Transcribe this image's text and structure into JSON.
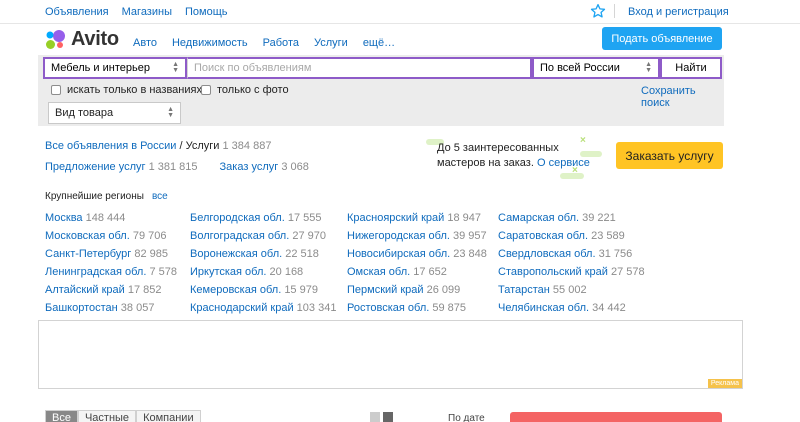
{
  "topbar": {
    "links": [
      "Объявления",
      "Магазины",
      "Помощь"
    ],
    "login": "Вход и регистрация"
  },
  "header": {
    "logo_text": "Avito",
    "categories": [
      "Авто",
      "Недвижимость",
      "Работа",
      "Услуги",
      "ещё…"
    ],
    "post_button": "Подать объявление"
  },
  "search": {
    "category": "Мебель и интерьер",
    "query_placeholder": "Поиск по объявлениям",
    "region": "По всей России",
    "find_button": "Найти",
    "only_titles": "искать только в названиях",
    "only_photo": "только с фото",
    "save_search": "Сохранить поиск",
    "product_type": "Вид товара"
  },
  "breadcrumb": {
    "all_ads": "Все объявления в России",
    "separator": "/",
    "current": "Услуги",
    "current_count": "1 384 887"
  },
  "offers": [
    {
      "label": "Предложение услуг",
      "count": "1 381 815"
    },
    {
      "label": "Заказ услуг",
      "count": "3 068"
    }
  ],
  "promo": {
    "line1": "До 5 заинтересованных",
    "line2": "мастеров на заказ.",
    "about": "О сервисе",
    "order_button": "Заказать услугу"
  },
  "regions": {
    "heading": "Крупнейшие регионы",
    "all": "все",
    "columns": [
      [
        {
          "name": "Москва",
          "count": "148 444"
        },
        {
          "name": "Московская обл.",
          "count": "79 706"
        },
        {
          "name": "Санкт-Петербург",
          "count": "82 985"
        },
        {
          "name": "Ленинградская обл.",
          "count": "7 578"
        },
        {
          "name": "Алтайский край",
          "count": "17 852"
        },
        {
          "name": "Башкортостан",
          "count": "38 057"
        }
      ],
      [
        {
          "name": "Белгородская обл.",
          "count": "17 555"
        },
        {
          "name": "Волгоградская обл.",
          "count": "27 970"
        },
        {
          "name": "Воронежская обл.",
          "count": "22 518"
        },
        {
          "name": "Иркутская обл.",
          "count": "20 168"
        },
        {
          "name": "Кемеровская обл.",
          "count": "15 979"
        },
        {
          "name": "Краснодарский край",
          "count": "103 341"
        }
      ],
      [
        {
          "name": "Красноярский край",
          "count": "18 947"
        },
        {
          "name": "Нижегородская обл.",
          "count": "39 957"
        },
        {
          "name": "Новосибирская обл.",
          "count": "23 848"
        },
        {
          "name": "Омская обл.",
          "count": "17 652"
        },
        {
          "name": "Пермский край",
          "count": "26 099"
        },
        {
          "name": "Ростовская обл.",
          "count": "59 875"
        }
      ],
      [
        {
          "name": "Самарская обл.",
          "count": "39 221"
        },
        {
          "name": "Саратовская обл.",
          "count": "23 589"
        },
        {
          "name": "Свердловская обл.",
          "count": "31 756"
        },
        {
          "name": "Ставропольский край",
          "count": "27 578"
        },
        {
          "name": "Татарстан",
          "count": "55 002"
        },
        {
          "name": "Челябинская обл.",
          "count": "34 442"
        }
      ]
    ]
  },
  "ad": {
    "label": "Реклама"
  },
  "bottom": {
    "tabs": [
      "Все",
      "Частные",
      "Компании"
    ],
    "sort": "По дате"
  },
  "colors": {
    "link": "#0f6bbd",
    "post_button": "#1fa4f2",
    "order_button": "#ffc424",
    "search_border": "#8e5bc8",
    "logo_purple": "#965eeb",
    "logo_blue": "#0af",
    "logo_green": "#97cf26",
    "logo_red": "#ff6163"
  }
}
